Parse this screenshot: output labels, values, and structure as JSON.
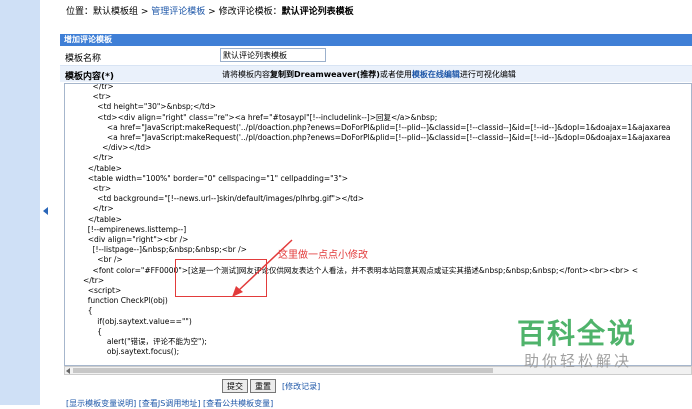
{
  "breadcrumb": {
    "prefix": "位置：",
    "home": "默认模板组",
    "sep1": " > ",
    "manage": "管理评论模板",
    "sep2": " > 修改评论模板：",
    "current": "默认评论列表模板"
  },
  "panel": {
    "title": "增加评论模板"
  },
  "form": {
    "name_label": "模板名称",
    "name_value": "默认评论列表模板",
    "content_label": "模板内容(*)",
    "hint_pre": "请将模板内容",
    "hint_bold": "复制到Dreamweaver(推荐)",
    "hint_mid": "或者使用",
    "hint_link": "模板在线编辑",
    "hint_post": "进行可视化编辑"
  },
  "code_lines": [
    "    </tr>",
    "    <tr>",
    "      <td height=\"30\">&nbsp;</td>",
    "      <td><div align=\"right\" class=\"re\"><a href=\"#tosaypl\"[!--includelink--]>回复</a>&nbsp;",
    "          <a href=\"JavaScript:makeRequest('../pl/doaction.php?enews=DoForPl&plid=[!--plid--]&classid=[!--classid--]&id=[!--id--]&dopl=1&doajax=1&ajaxarea",
    "          <a href=\"JavaScript:makeRequest('../pl/doaction.php?enews=DoForPl&plid=[!--plid--]&classid=[!--classid--]&id=[!--id--]&dopl=0&doajax=1&ajaxarea",
    "        </div></td>",
    "    </tr>",
    "  </table>",
    "  <table width=\"100%\" border=\"0\" cellspacing=\"1\" cellpadding=\"3\">",
    "    <tr>",
    "      <td background=\"[!--news.url--]skin/default/images/plhrbg.gif\"></td>",
    "    </tr>",
    "  </table>",
    "  [!--empirenews.listtemp--]",
    "  <div align=\"right\"><br />",
    "    [!--listpage--]&nbsp;&nbsp;&nbsp;<br />",
    "      <br />",
    "    <font color=\"#FF0000\">[这是一个测试]网友评论仅供网友表达个人看法，并不表明本站同意其观点或证实其描述&nbsp;&nbsp;&nbsp;</font><br><br> <",
    "</tr>",
    "  <script>",
    "  function CheckPl(obj)",
    "  {",
    "      if(obj.saytext.value==\"\")",
    "      {",
    "          alert(\"错误，评论不能为空\");",
    "          obj.saytext.focus();"
  ],
  "annotation": "这里做一点点小修改",
  "buttons": {
    "submit": "提交",
    "reset": "重置",
    "log": "[修改记录]"
  },
  "footer": "[显示模板变量说明]  [查看JS调用地址]  [查看公共模板变量]",
  "watermark": {
    "line1": "百科全说",
    "line2": "助你轻松解决"
  },
  "colors": {
    "panel_head": "#3f7fd6",
    "link": "#1e57a8",
    "annotation": "#e23b3b",
    "watermark": "#4fb36b"
  }
}
